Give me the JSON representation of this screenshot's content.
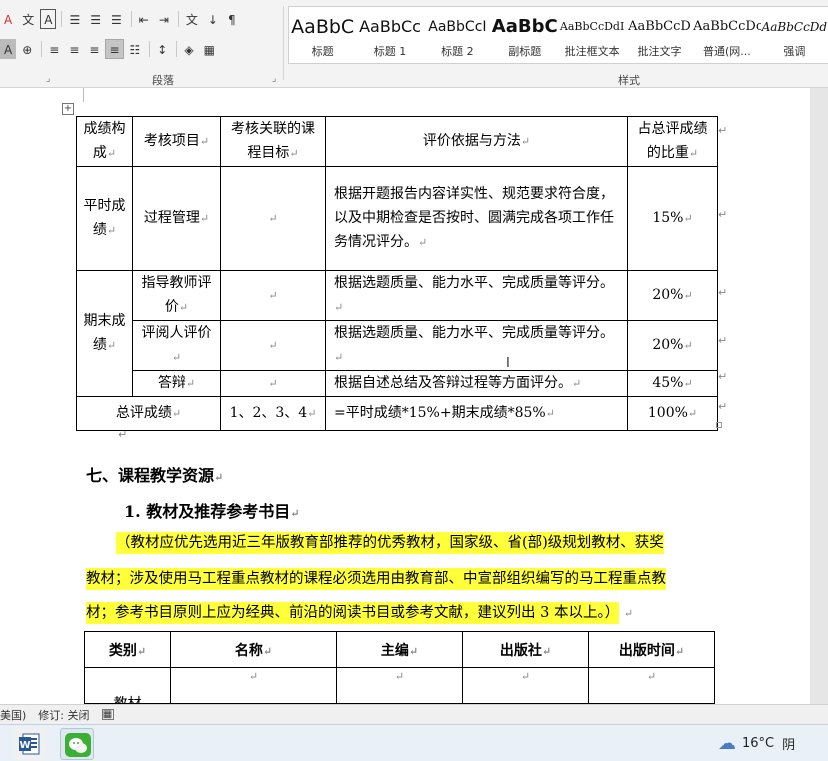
{
  "ribbon": {
    "paragraph_group_label": "段落",
    "styles_group_label": "样式",
    "font_row": [
      {
        "id": "text-effects",
        "glyph": "A"
      },
      {
        "id": "phonetic-guide",
        "glyph": "文"
      },
      {
        "id": "char-border",
        "glyph": "A"
      }
    ],
    "font_row2": [
      {
        "id": "char-shading",
        "glyph": "A"
      },
      {
        "id": "enclosed-char",
        "glyph": "⊕"
      }
    ],
    "paragraph_row1": [
      {
        "id": "bullets",
        "glyph": "☰"
      },
      {
        "id": "numbering",
        "glyph": "☰"
      },
      {
        "id": "multilevel-list",
        "glyph": "☰"
      },
      {
        "id": "decrease-indent",
        "glyph": "⇤"
      },
      {
        "id": "increase-indent",
        "glyph": "⇥"
      },
      {
        "id": "chinese-layout",
        "glyph": "文"
      },
      {
        "id": "sort",
        "glyph": "↓"
      },
      {
        "id": "show-hide-marks",
        "glyph": "¶"
      }
    ],
    "paragraph_row2": [
      {
        "id": "align-left",
        "glyph": "≡"
      },
      {
        "id": "align-center",
        "glyph": "≡"
      },
      {
        "id": "align-right",
        "glyph": "≡"
      },
      {
        "id": "justify",
        "glyph": "≡"
      },
      {
        "id": "distributed",
        "glyph": "☷"
      },
      {
        "id": "line-spacing",
        "glyph": "↕"
      },
      {
        "id": "shading",
        "glyph": "◈"
      },
      {
        "id": "borders",
        "glyph": "▦"
      }
    ],
    "styles": [
      {
        "preview": "AaBbC",
        "name": "标题",
        "size": 19,
        "bold": false
      },
      {
        "preview": "AaBbCc",
        "name": "标题 1",
        "size": 16,
        "bold": false
      },
      {
        "preview": "AaBbCcI",
        "name": "标题 2",
        "size": 14,
        "bold": false
      },
      {
        "preview": "AaBbC",
        "name": "副标题",
        "size": 18,
        "bold": true
      },
      {
        "preview": "AaBbCcDdI",
        "name": "批注框文本",
        "size": 11,
        "bold": false
      },
      {
        "preview": "AaBbCcD",
        "name": "批注文字",
        "size": 13,
        "bold": false
      },
      {
        "preview": "AaBbCcDc",
        "name": "普通(网...",
        "size": 13,
        "bold": false
      },
      {
        "preview": "AaBbCcDd",
        "name": "强调",
        "size": 12,
        "bold": false
      }
    ]
  },
  "assessment_table": {
    "headers": [
      "成绩构成",
      "考核项目",
      "考核关联的课程目标",
      "评价依据与方法",
      "占总评成绩的比重"
    ],
    "rows": {
      "daily_group": "平时成绩",
      "daily_item": "过程管理",
      "daily_method": "根据开题报告内容详实性、规范要求符合度，以及中期检查是否按时、圆满完成各项工作任务情况评分。",
      "daily_weight": "15%",
      "final_group": "期末成绩",
      "advisor_item": "指导教师评价",
      "advisor_method": "根据选题质量、能力水平、完成质量等评分。",
      "advisor_weight": "20%",
      "reviewer_item": "评阅人评价",
      "reviewer_method": "根据选题质量、能力水平、完成质量等评分。",
      "reviewer_weight": "20%",
      "defense_item": "答辩",
      "defense_method": "根据自述总结及答辩过程等方面评分。",
      "defense_weight": "45%",
      "total_label": "总评成绩",
      "total_targets": "1、2、3、4",
      "total_formula": "=平时成绩*15%+期末成绩*85%",
      "total_weight": "100%"
    }
  },
  "section": {
    "heading": "七、课程教学资源",
    "subheading": "1. 教材及推荐参考书目",
    "note_lines": [
      "（教材应优先选用近三年版教育部推荐的优秀教材，国家级、省(部)级规划教材、获奖",
      "教材；涉及使用马工程重点教材的课程必须选用由教育部、中宣部组织编写的马工程重点教",
      "材；参考书目原则上应为经典、前沿的阅读书目或参考文献，建议列出 3 本以上。）"
    ]
  },
  "books_table": {
    "headers": [
      "类别",
      "名称",
      "主编",
      "出版社",
      "出版时间"
    ],
    "first_row_category": "教材"
  },
  "statusbar": {
    "language": "美国)",
    "track_changes": "修订: 关闭"
  },
  "taskbar": {
    "temperature": "16°C",
    "weather": "阴"
  },
  "paragraph_mark": "↵",
  "colors": {
    "highlight": "#ffff3a",
    "word_blue": "#2b579a",
    "wechat_green": "#3cb034"
  }
}
